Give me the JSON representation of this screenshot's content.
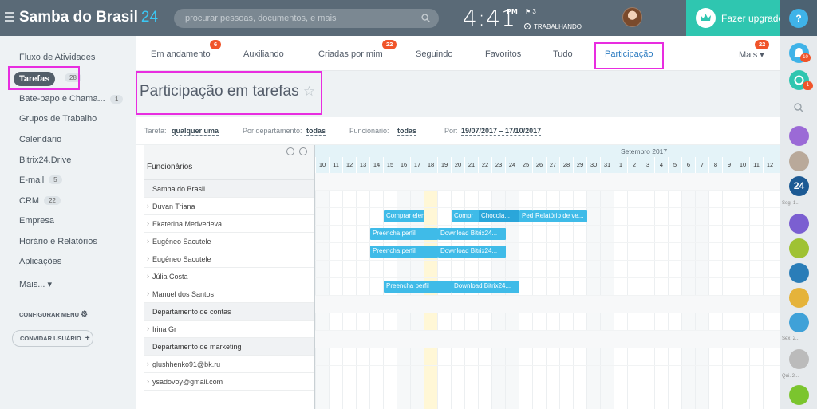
{
  "app": {
    "name": "Samba do Brasil",
    "num": "24",
    "search_placeholder": "procurar pessoas, documentos, e mais",
    "time": "4:41",
    "ampm": "PM",
    "flag_count": "3",
    "work_status": "TRABALHANDO",
    "upgrade": "Fazer upgrade",
    "help": "?"
  },
  "sidebar": {
    "fluxo": "Fluxo de Atividades",
    "tarefas": "Tarefas",
    "tarefas_count": "28",
    "bate": "Bate-papo e Chama...",
    "bate_count": "1",
    "grupos": "Grupos de Trabalho",
    "calendario": "Calendário",
    "drive": "Bitrix24.Drive",
    "email": "E-mail",
    "email_count": "5",
    "crm": "CRM",
    "crm_count": "22",
    "empresa": "Empresa",
    "horario": "Horário e Relatórios",
    "aplicacoes": "Aplicações",
    "mais": "Mais...",
    "configurar": "CONFIGURAR MENU",
    "convidar": "CONVIDAR USUÁRIO"
  },
  "tabs": {
    "andamento": "Em andamento",
    "andamento_badge": "6",
    "auxiliando": "Auxiliando",
    "criadas": "Criadas por mim",
    "criadas_badge": "22",
    "seguindo": "Seguindo",
    "favoritos": "Favoritos",
    "tudo": "Tudo",
    "participacao": "Participação",
    "mais": "Mais",
    "mais_badge": "22"
  },
  "page": {
    "title": "Participação em tarefas",
    "star": "☆"
  },
  "filters": {
    "tarefa_label": "Tarefa:",
    "tarefa_value": "qualquer uma",
    "dept_label": "Por departamento:",
    "dept_value": "todas",
    "func_label": "Funcionário:",
    "func_value": "todas",
    "por_label": "Por:",
    "por_value": "19/07/2017 – 17/10/2017"
  },
  "gantt": {
    "header": "Funcionários",
    "month": "Setembro 2017",
    "days": [
      "10",
      "11",
      "12",
      "13",
      "14",
      "15",
      "16",
      "17",
      "18",
      "19",
      "20",
      "21",
      "22",
      "23",
      "24",
      "25",
      "26",
      "27",
      "28",
      "29",
      "30",
      "31",
      "1",
      "2",
      "3",
      "4",
      "5",
      "6",
      "7",
      "8",
      "9",
      "10",
      "11",
      "12"
    ],
    "rows": [
      {
        "label": "Samba do Brasil",
        "group": true
      },
      {
        "label": "Duvan Triana",
        "group": false
      },
      {
        "label": "Ekaterina Medvedeva",
        "group": false
      },
      {
        "label": "Eugêneo Sacutele",
        "group": false
      },
      {
        "label": "Eugêneo Sacutele",
        "group": false
      },
      {
        "label": "Júlia Costa",
        "group": false
      },
      {
        "label": "Manuel dos Santos",
        "group": false
      },
      {
        "label": "Departamento de contas",
        "group": true
      },
      {
        "label": "Irina Gr",
        "group": false
      },
      {
        "label": "Departamento de marketing",
        "group": true
      },
      {
        "label": "glushhenko91@bk.ru",
        "group": false
      },
      {
        "label": "ysadovoy@gmail.com",
        "group": false
      }
    ],
    "bars": [
      {
        "row": 2,
        "start_day": "15",
        "end_day": "18",
        "label": "Comprar elem..."
      },
      {
        "row": 2,
        "start_day": "20",
        "end_day": "24",
        "label": "Compr"
      },
      {
        "row": 2,
        "start_day": "22",
        "end_day": "25",
        "label": "Chocola..."
      },
      {
        "row": 2,
        "start_day": "25",
        "end_day": "26",
        "label": "Pedir"
      },
      {
        "row": 2,
        "start_day": "26",
        "end_day": "27",
        "label": "I"
      },
      {
        "row": 2,
        "start_day": "26",
        "end_day": "30",
        "label": "Relatório de ve..."
      },
      {
        "row": 3,
        "start_day": "14",
        "end_day": "19",
        "label": "Preencha perfil"
      },
      {
        "row": 3,
        "start_day": "19",
        "end_day": "24",
        "label": "Download Bitrix24..."
      },
      {
        "row": 4,
        "start_day": "14",
        "end_day": "19",
        "label": "Preencha perfil"
      },
      {
        "row": 4,
        "start_day": "19",
        "end_day": "24",
        "label": "Download Bitrix24..."
      },
      {
        "row": 6,
        "start_day": "15",
        "end_day": "20",
        "label": "Preencha perfil"
      },
      {
        "row": 6,
        "start_day": "20",
        "end_day": "25",
        "label": "Download Bitrix24..."
      }
    ]
  },
  "rail": {
    "notif_badge": "10",
    "second_badge": "1",
    "label_seg": "Seg. 1...",
    "label_sex": "Sex. 2...",
    "label_qui": "Qui. 2..."
  }
}
